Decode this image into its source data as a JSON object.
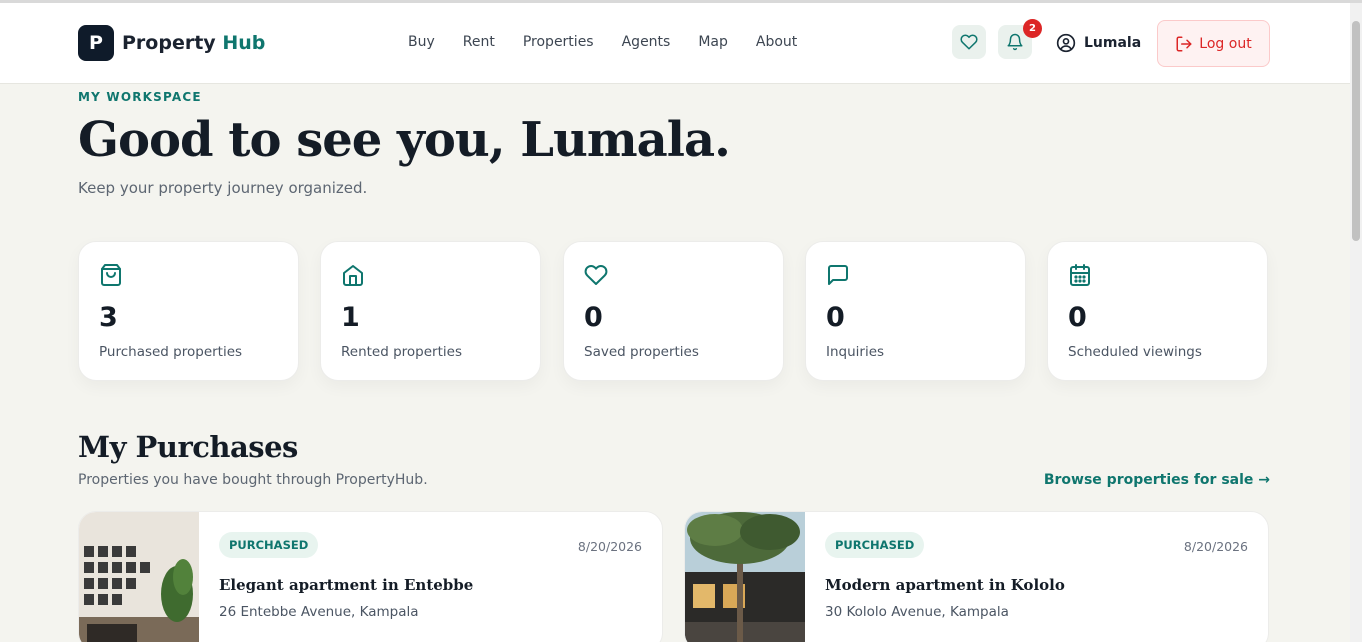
{
  "brand": {
    "mark": "P",
    "name_main": "Property",
    "name_accent": "Hub"
  },
  "nav": {
    "items": [
      "Buy",
      "Rent",
      "Properties",
      "Agents",
      "Map",
      "About"
    ]
  },
  "header": {
    "notification_count": "2",
    "username": "Lumala",
    "logout_label": "Log out"
  },
  "hero": {
    "eyebrow": "MY WORKSPACE",
    "title": "Good to see you, Lumala.",
    "subtitle": "Keep your property journey organized."
  },
  "stats": [
    {
      "icon": "shopping-bag-icon",
      "value": "3",
      "label": "Purchased properties"
    },
    {
      "icon": "home-icon",
      "value": "1",
      "label": "Rented properties"
    },
    {
      "icon": "heart-icon",
      "value": "0",
      "label": "Saved properties"
    },
    {
      "icon": "message-icon",
      "value": "0",
      "label": "Inquiries"
    },
    {
      "icon": "calendar-icon",
      "value": "0",
      "label": "Scheduled viewings"
    }
  ],
  "purchases": {
    "title": "My Purchases",
    "subtitle": "Properties you have bought through PropertyHub.",
    "link": "Browse properties for sale →",
    "items": [
      {
        "status": "PURCHASED",
        "date": "8/20/2026",
        "title": "Elegant apartment in Entebbe",
        "address": "26 Entebbe Avenue, Kampala"
      },
      {
        "status": "PURCHASED",
        "date": "8/20/2026",
        "title": "Modern apartment in Kololo",
        "address": "30 Kololo Avenue, Kampala"
      }
    ]
  },
  "colors": {
    "accent": "#0f766e",
    "danger": "#dc2626",
    "background": "#f4f4ef",
    "dark": "#0f1b2a"
  }
}
